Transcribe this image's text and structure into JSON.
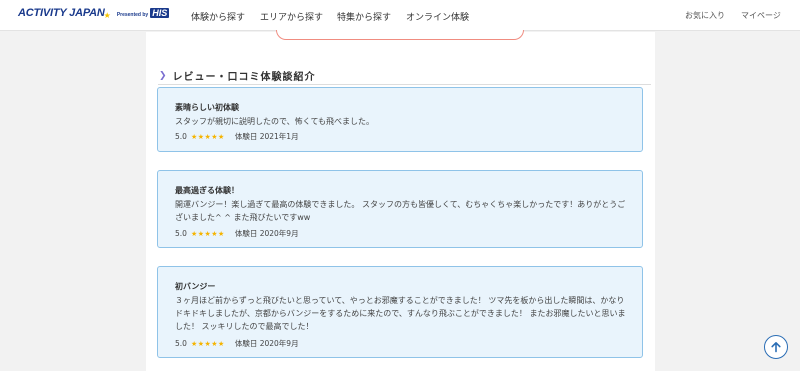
{
  "header": {
    "logo": {
      "main": "ACTIVITY JAPAN",
      "presented_by": "Presented by",
      "brand": "HIS"
    },
    "nav": [
      {
        "label": "体験から探す"
      },
      {
        "label": "エリアから探す"
      },
      {
        "label": "特集から探す"
      },
      {
        "label": "オンライン体験"
      }
    ],
    "favorites_label": "お気に入り",
    "mypage_label": "マイページ"
  },
  "section": {
    "heading": "レビュー・口コミ体験談紹介"
  },
  "reviews": [
    {
      "title": "素晴らしい初体験",
      "body": "スタッフが親切に説明したので、怖くても飛べました。",
      "rating": "5.0",
      "stars": "★★★★★",
      "date": "体験日 2021年1月"
    },
    {
      "title": "最高過ぎる体験！",
      "body": "開運バンジー！楽し過ぎて最高の体験できました。 スタッフの方も皆優しくて、むちゃくちゃ楽しかったです！ありがとうございました^ ^ また飛びたいですww",
      "rating": "5.0",
      "stars": "★★★★★",
      "date": "体験日 2020年9月"
    },
    {
      "title": "初バンジー",
      "body": "３ヶ月ほど前からずっと飛びたいと思っていて、やっとお邪魔することができました！ ツマ先を板から出した瞬間は、かなりドキドキしましたが、京都からバンジーをするために来たので、すんなり飛ぶことができました！ またお邪魔したいと思いました！ スッキリしたので最高でした！",
      "rating": "5.0",
      "stars": "★★★★★",
      "date": "体験日 2020年9月"
    }
  ],
  "icons": {
    "back_to_top": "arrow-up-icon",
    "heading_marker": "chevron-right-icon"
  },
  "colors": {
    "brand": "#1a3a8c",
    "card_bg": "#e9f4fc",
    "card_border": "#8fc3e8",
    "star": "#f5b400",
    "accent_pill": "#f08c80"
  }
}
